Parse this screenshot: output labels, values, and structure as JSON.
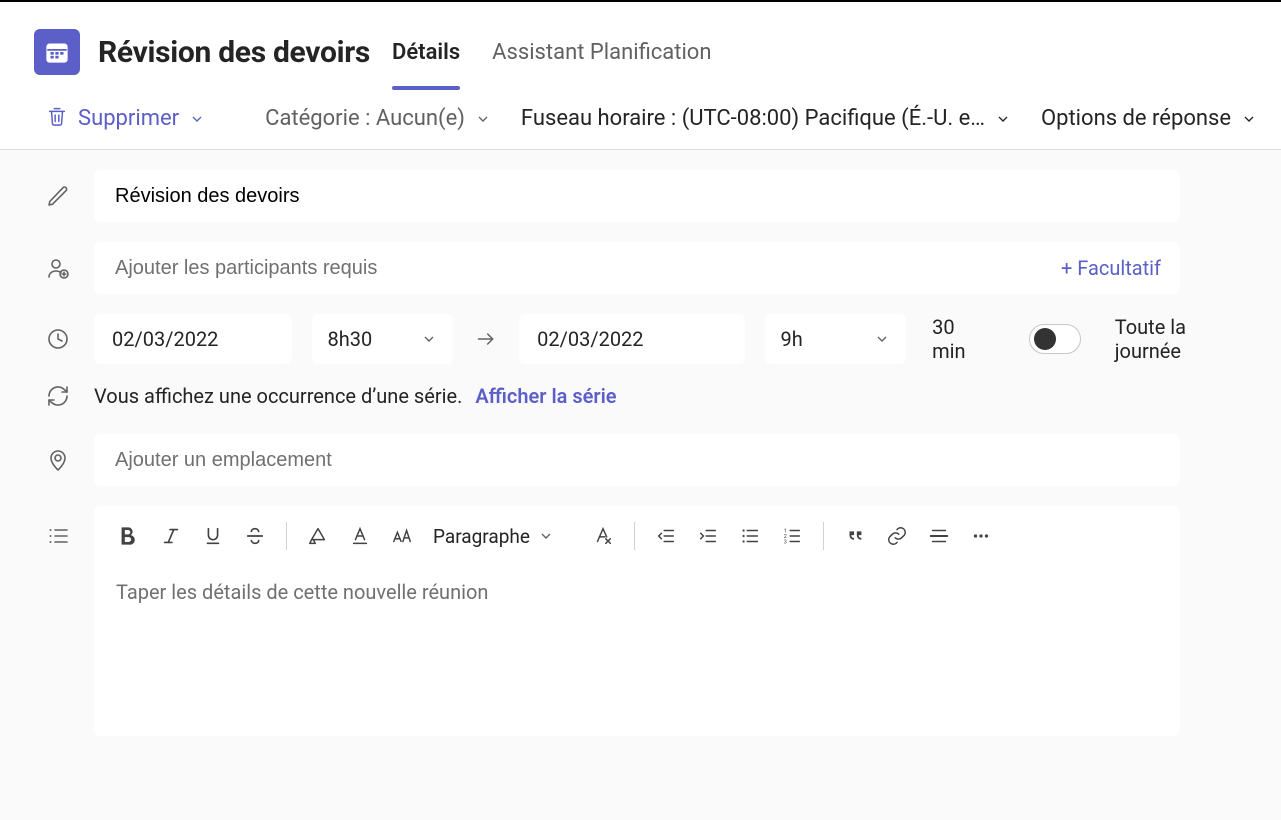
{
  "header": {
    "title": "Révision des devoirs",
    "tabs": [
      "Détails",
      "Assistant Planification"
    ],
    "active_tab_index": 0
  },
  "toolbar": {
    "delete_label": "Supprimer",
    "category_label": "Catégorie : Aucun(e)",
    "timezone_label": "Fuseau horaire : (UTC-08:00) Pacifique (É.-U. e…",
    "response_options_label": "Options de réponse"
  },
  "form": {
    "title_value": "Révision des devoirs",
    "attendees_placeholder": "Ajouter les participants requis",
    "optional_label": "+ Facultatif",
    "start_date": "02/03/2022",
    "start_time": "8h30",
    "end_date": "02/03/2022",
    "end_time": "9h",
    "duration": "30 min",
    "all_day_label": "Toute la journée",
    "all_day": false,
    "series_text": "Vous affichez une occurrence d’une série.",
    "series_link": "Afficher la série",
    "location_placeholder": "Ajouter un emplacement",
    "editor": {
      "paragraph_label": "Paragraphe",
      "placeholder": "Taper les détails de cette nouvelle réunion"
    }
  },
  "colors": {
    "accent": "#5b5fc7"
  }
}
